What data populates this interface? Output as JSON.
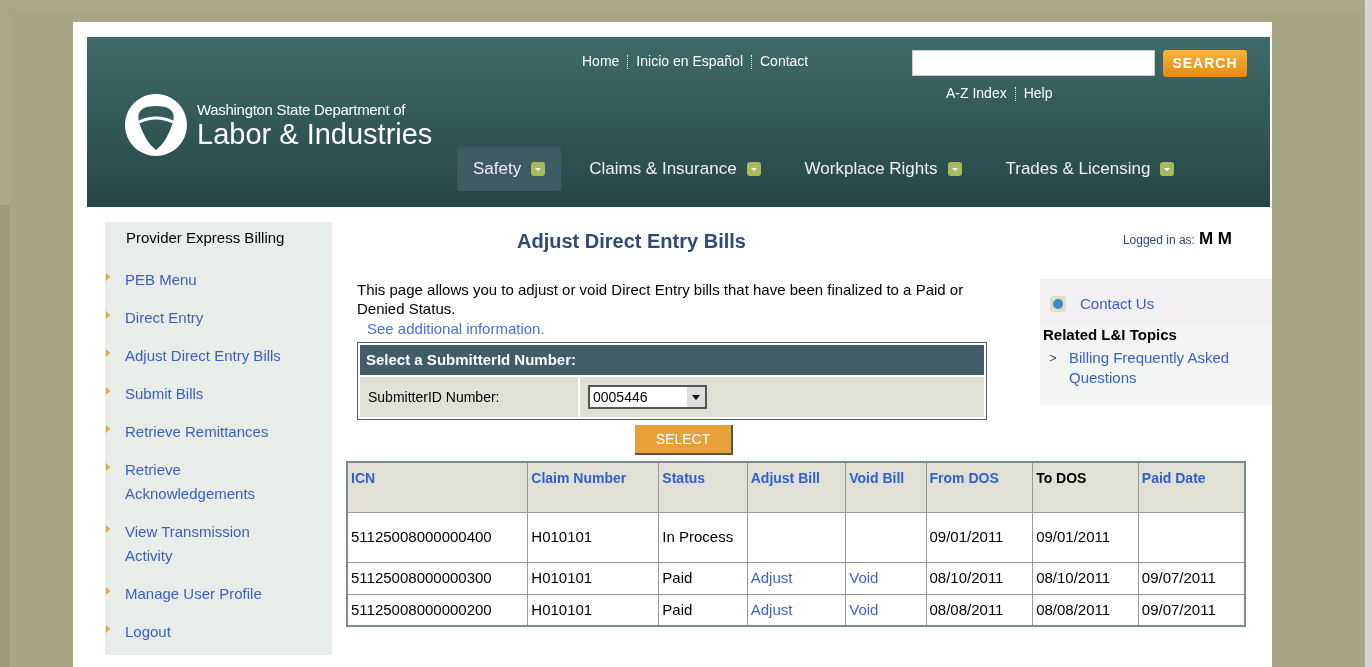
{
  "header": {
    "org_line1": "Washington State Department of",
    "org_line2": "Labor & Industries",
    "top_links": [
      "Home",
      "Inicio en Español",
      "Contact"
    ],
    "search": {
      "button": "SEARCH"
    },
    "util_links": [
      "A-Z Index",
      "Help"
    ],
    "nav": [
      {
        "label": "Safety",
        "selected": true
      },
      {
        "label": "Claims & Insurance",
        "selected": false
      },
      {
        "label": "Workplace Rights",
        "selected": false
      },
      {
        "label": "Trades & Licensing",
        "selected": false
      }
    ]
  },
  "sidebar": {
    "title": "Provider Express Billing",
    "items": [
      "PEB Menu",
      "Direct Entry",
      "Adjust Direct Entry Bills",
      "Submit Bills",
      "Retrieve Remittances",
      "Retrieve Acknowledgements",
      "View Transmission Activity",
      "Manage User Profile",
      "Logout"
    ]
  },
  "main": {
    "title": "Adjust Direct Entry Bills",
    "logged_in_label": "Logged in as:",
    "logged_in_user": "M M",
    "intro": "This page allows you to adjust or void Direct Entry bills that have been finalized to a Paid or Denied Status.",
    "more_link": "See additional information.",
    "form": {
      "heading": "Select a SubmitterId Number:",
      "label": "SubmitterID Number:",
      "value": "0005446",
      "button": "SELECT"
    },
    "table": {
      "columns": [
        {
          "label": "ICN",
          "link": true
        },
        {
          "label": "Claim Number",
          "link": true
        },
        {
          "label": "Status",
          "link": true
        },
        {
          "label": "Adjust Bill",
          "link": true
        },
        {
          "label": "Void Bill",
          "link": true
        },
        {
          "label": "From DOS",
          "link": true
        },
        {
          "label": "To DOS",
          "link": false
        },
        {
          "label": "Paid Date",
          "link": true
        }
      ],
      "rows": [
        {
          "cells": [
            {
              "kind": "text",
              "text": "51125008000000400"
            },
            {
              "kind": "text",
              "text": "H010101"
            },
            {
              "kind": "text",
              "text": "In Process"
            },
            {
              "kind": "blank"
            },
            {
              "kind": "blank"
            },
            {
              "kind": "text",
              "text": "09/01/2011"
            },
            {
              "kind": "text",
              "text": "09/01/2011"
            },
            {
              "kind": "blank"
            }
          ]
        },
        {
          "cells": [
            {
              "kind": "text",
              "text": "51125008000000300"
            },
            {
              "kind": "text",
              "text": "H010101"
            },
            {
              "kind": "text",
              "text": "Paid"
            },
            {
              "kind": "link",
              "text": "Adjust"
            },
            {
              "kind": "link",
              "text": "Void"
            },
            {
              "kind": "text",
              "text": "08/10/2011"
            },
            {
              "kind": "text",
              "text": "08/10/2011"
            },
            {
              "kind": "text",
              "text": "09/07/2011"
            }
          ]
        },
        {
          "cells": [
            {
              "kind": "text",
              "text": "51125008000000200"
            },
            {
              "kind": "text",
              "text": "H010101"
            },
            {
              "kind": "text",
              "text": "Paid"
            },
            {
              "kind": "link",
              "text": "Adjust"
            },
            {
              "kind": "link",
              "text": "Void"
            },
            {
              "kind": "text",
              "text": "08/08/2011"
            },
            {
              "kind": "text",
              "text": "08/08/2011"
            },
            {
              "kind": "text",
              "text": "09/07/2011"
            }
          ]
        }
      ]
    }
  },
  "aside": {
    "contact": "Contact Us",
    "topics_title": "Related L&I Topics",
    "topics": [
      "Billing Frequently Asked Questions"
    ]
  }
}
